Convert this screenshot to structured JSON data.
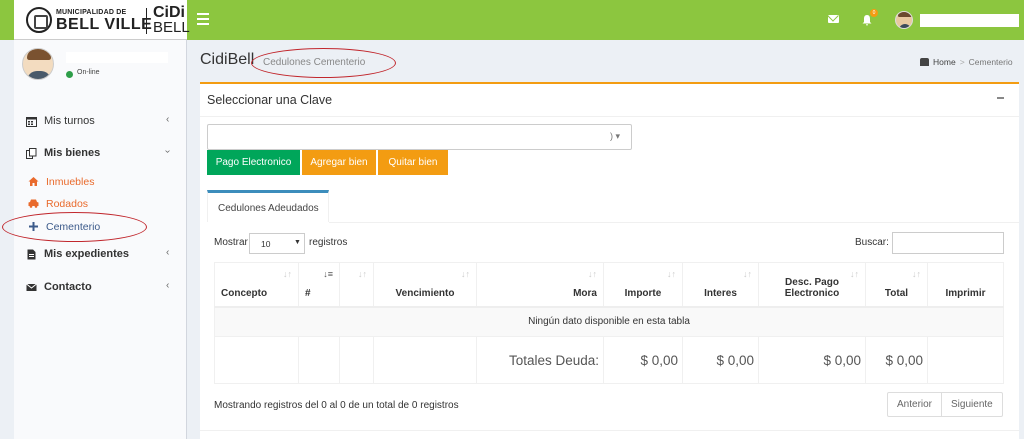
{
  "header": {
    "logo_muni": "MUNICIPALIDAD DE",
    "logo_city": "BELL VILLE",
    "logo_cidi": "CiDi",
    "logo_bell": "BELL",
    "notification_count": "0"
  },
  "sidebar": {
    "status": "On-line",
    "items": [
      {
        "label": "Mis turnos",
        "icon": "calendar-icon"
      },
      {
        "label": "Mis bienes",
        "icon": "copy-icon"
      },
      {
        "label": "Mis expedientes",
        "icon": "file-icon"
      },
      {
        "label": "Contacto",
        "icon": "envelope-icon"
      }
    ],
    "subitems": [
      {
        "label": "Inmuebles",
        "icon": "home-icon",
        "color": "#e96a2c"
      },
      {
        "label": "Rodados",
        "icon": "car-icon",
        "color": "#e96a2c"
      },
      {
        "label": "Cementerio",
        "icon": "plus-icon",
        "color": "#3c8dbc"
      }
    ]
  },
  "content": {
    "title": "CidiBell",
    "subtitle": "Cedulones Cementerio",
    "breadcrumb_home": "Home",
    "breadcrumb_current": "Cementerio"
  },
  "box": {
    "title": "Seleccionar una Clave",
    "select_value": ")",
    "buttons": {
      "pago": "Pago Electronico",
      "agregar": "Agregar bien",
      "quitar": "Quitar bien"
    },
    "tab": "Cedulones Adeudados",
    "length_label": "Mostrar",
    "length_value": "10",
    "length_after": "registros",
    "search_label": "Buscar:",
    "columns": [
      "Concepto",
      "#",
      "",
      "Vencimiento",
      "Mora",
      "Importe",
      "Interes",
      "Desc. Pago Electronico",
      "Total",
      "Imprimir"
    ],
    "empty_message": "Ningún dato disponible en esta tabla",
    "totals_label": "Totales Deuda:",
    "totals": [
      "$ 0,00",
      "$ 0,00",
      "$ 0,00",
      "$ 0,00"
    ],
    "info": "Mostrando registros del 0 al 0 de un total de 0 registros",
    "prev": "Anterior",
    "next": "Siguiente"
  },
  "colors": {
    "header_green": "#8cc63f",
    "accent_orange": "#f39c12",
    "button_green": "#00a65a",
    "link_blue": "#3c8dbc",
    "highlight_red": "#c1272d"
  }
}
